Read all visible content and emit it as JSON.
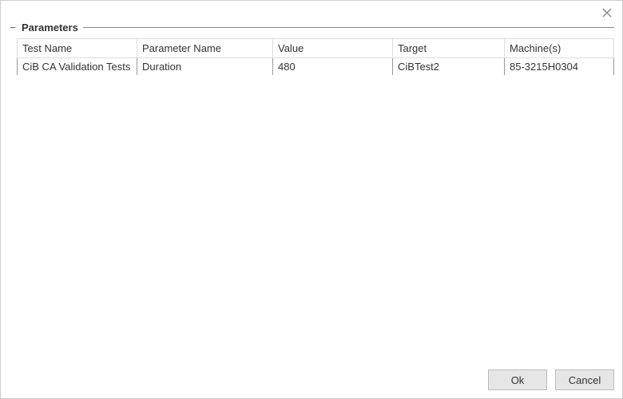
{
  "groupbox": {
    "title": "Parameters"
  },
  "table": {
    "headers": {
      "testName": "Test Name",
      "parameterName": "Parameter Name",
      "value": "Value",
      "target": "Target",
      "machines": "Machine(s)"
    },
    "rows": [
      {
        "testName": "CiB CA Validation Tests",
        "parameterName": "Duration",
        "value": "480",
        "target": "CiBTest2",
        "machines": "85-3215H0304"
      }
    ]
  },
  "buttons": {
    "ok": "Ok",
    "cancel": "Cancel"
  }
}
